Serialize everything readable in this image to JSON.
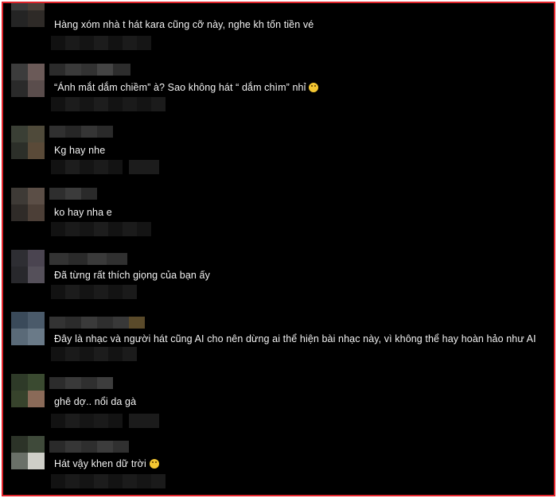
{
  "comments": [
    {
      "text": "Hàng xóm nhà t hát kara cũng cỡ này, nghe kh tốn tiền vé",
      "emoji": ""
    },
    {
      "text": "“Ánh mắt dắm chiềm” à? Sao không hát “ dắm chìm” nhỉ",
      "emoji": "grinning-emoji"
    },
    {
      "text": "Kg hay nhe",
      "emoji": ""
    },
    {
      "text": "ko hay nha e",
      "emoji": ""
    },
    {
      "text": "Đã từng rất thích giọng của bạn ấy",
      "emoji": ""
    },
    {
      "text": "Đây là nhạc và người hát cũng AI cho nên dừng ai thể hiện bài nhạc này, vì không thể hay hoàn hảo như AI",
      "emoji": ""
    },
    {
      "text": "ghê dợ.. nổi da gà",
      "emoji": ""
    },
    {
      "text": "Hát vậy khen dữ trời",
      "emoji": "laughing-emoji"
    }
  ],
  "colors": {
    "frame_border": "#e0242b",
    "background": "#000000",
    "text": "#f2f2f2"
  }
}
